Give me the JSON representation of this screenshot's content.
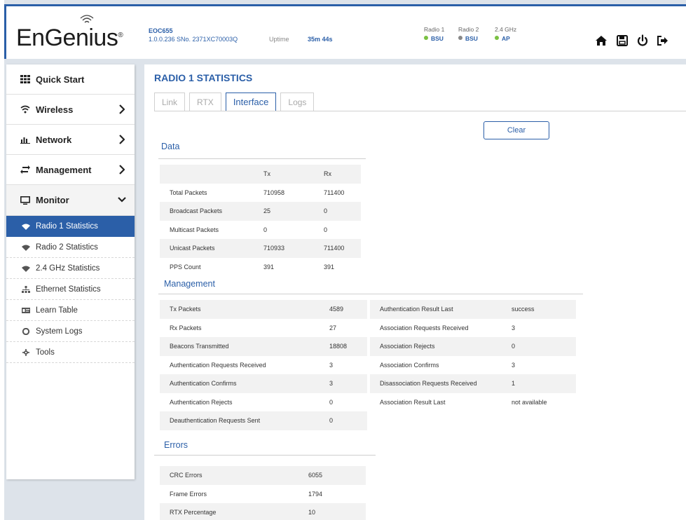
{
  "header": {
    "logo": "EnGenius",
    "logo_mark": "®",
    "model": "EOC655",
    "firmware_serial": "1.0.0.236 SNo. 2371XC70003Q",
    "uptime_label": "Uptime",
    "uptime_value": "35m 44s",
    "radios": [
      {
        "label": "Radio 1",
        "status": "BSU",
        "color": "#7ac142"
      },
      {
        "label": "Radio 2",
        "status": "BSU",
        "color": "#888888"
      },
      {
        "label": "2.4 GHz",
        "status": "AP",
        "color": "#7ac142"
      }
    ],
    "icons": [
      "home-icon",
      "save-icon",
      "power-icon",
      "logout-icon"
    ]
  },
  "sidebar": {
    "menu": [
      {
        "label": "Quick Start",
        "icon": "grid-icon"
      },
      {
        "label": "Wireless",
        "icon": "wifi-icon"
      },
      {
        "label": "Network",
        "icon": "bar-chart-icon"
      },
      {
        "label": "Management",
        "icon": "exchange-icon"
      },
      {
        "label": "Monitor",
        "icon": "monitor-icon"
      }
    ],
    "submenu": [
      {
        "label": "Radio 1 Statistics",
        "icon": "wifi-icon"
      },
      {
        "label": "Radio 2 Statistics",
        "icon": "wifi-icon"
      },
      {
        "label": "2.4 GHz Statistics",
        "icon": "wifi-icon"
      },
      {
        "label": "Ethernet Statistics",
        "icon": "sitemap-icon"
      },
      {
        "label": "Learn Table",
        "icon": "id-card-icon"
      },
      {
        "label": "System Logs",
        "icon": "lifebuoy-icon"
      },
      {
        "label": "Tools",
        "icon": "gear-icon"
      }
    ]
  },
  "main": {
    "title": "RADIO 1 STATISTICS",
    "tabs": [
      "Link",
      "RTX",
      "Interface",
      "Logs"
    ],
    "active_tab": "Interface",
    "clear_label": "Clear",
    "data": {
      "title": "Data",
      "headers": [
        "",
        "Tx",
        "Rx"
      ],
      "rows": [
        [
          "Total Packets",
          "710958",
          "711400"
        ],
        [
          "Broadcast Packets",
          "25",
          "0"
        ],
        [
          "Multicast Packets",
          "0",
          "0"
        ],
        [
          "Unicast Packets",
          "710933",
          "711400"
        ],
        [
          "PPS Count",
          "391",
          "391"
        ]
      ]
    },
    "management": {
      "title": "Management",
      "left": [
        [
          "Tx Packets",
          "4589"
        ],
        [
          "Rx Packets",
          "27"
        ],
        [
          "Beacons Transmitted",
          "18808"
        ],
        [
          "Authentication Requests Received",
          "3"
        ],
        [
          "Authentication Confirms",
          "3"
        ],
        [
          "Authentication Rejects",
          "0"
        ],
        [
          "Deauthentication Requests Sent",
          "0"
        ]
      ],
      "right": [
        [
          "Authentication Result Last",
          "success"
        ],
        [
          "Association Requests Received",
          "3"
        ],
        [
          "Association Rejects",
          "0"
        ],
        [
          "Association Confirms",
          "3"
        ],
        [
          "Disassociation Requests Received",
          "1"
        ],
        [
          "Association Result Last",
          "not available"
        ]
      ]
    },
    "errors": {
      "title": "Errors",
      "rows": [
        [
          "CRC Errors",
          "6055"
        ],
        [
          "Frame Errors",
          "1794"
        ],
        [
          "RTX Percentage",
          "10"
        ]
      ]
    }
  },
  "colors": {
    "accent": "#2b5fa8",
    "status_green": "#7ac142"
  }
}
